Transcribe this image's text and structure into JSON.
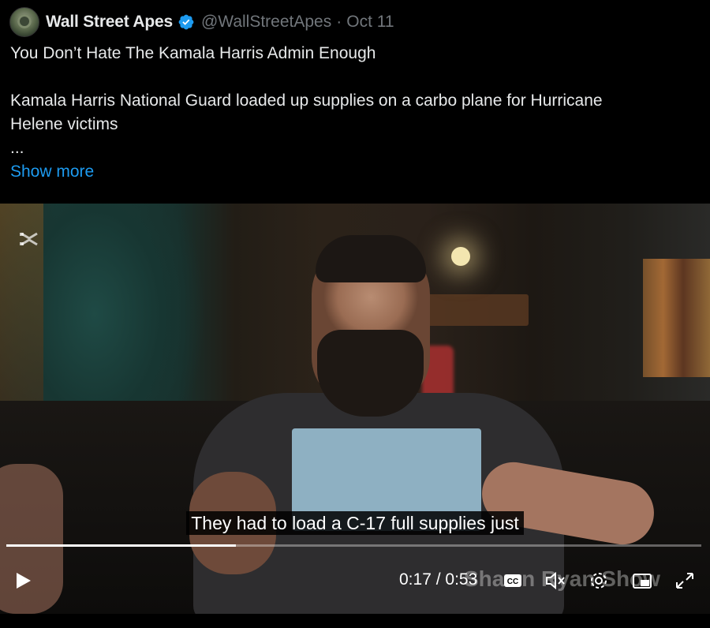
{
  "author": {
    "name": "Wall Street Apes",
    "handle": "@WallStreetApes",
    "separator": "·",
    "date": "Oct 11"
  },
  "tweet": {
    "line1": "You Don’t Hate The Kamala Harris Admin Enough",
    "line2": "Kamala Harris National Guard loaded up supplies on a carbo plane for Hurricane",
    "line3": "Helene victims",
    "ellipsis": "...",
    "show_more": "Show more"
  },
  "video": {
    "subtitle": "They had to load a C-17 full supplies just",
    "current_time": "0:17",
    "time_separator": " / ",
    "duration": "0:53",
    "progress": 0.33,
    "watermark": "Shawn Ryan Show"
  },
  "icons": {
    "verified": "verified-badge-icon",
    "play": "play-icon",
    "captions": "cc-icon",
    "mute": "mute-icon",
    "settings": "gear-icon",
    "pip": "picture-in-picture-icon",
    "fullscreen": "fullscreen-icon",
    "capcut": "capcut-logo-icon"
  },
  "colors": {
    "link": "#1d9bf0",
    "verified": "#1d9bf0",
    "secondary_text": "#71767b"
  }
}
